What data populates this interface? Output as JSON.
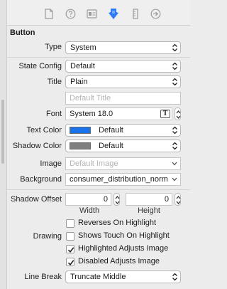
{
  "section_title": "Button",
  "type": {
    "label": "Type",
    "value": "System"
  },
  "state_config": {
    "label": "State Config",
    "value": "Default"
  },
  "title": {
    "label": "Title",
    "value": "Plain",
    "placeholder": "Default Title"
  },
  "font": {
    "label": "Font",
    "value": "System 18.0",
    "button_glyph": "T"
  },
  "text_color": {
    "label": "Text Color",
    "value": "Default",
    "swatch": "#1a73e8"
  },
  "shadow_color": {
    "label": "Shadow Color",
    "value": "Default",
    "swatch": "#7f7f7f"
  },
  "image": {
    "label": "Image",
    "placeholder": "Default Image"
  },
  "background": {
    "label": "Background",
    "value": "consumer_distribution_norm"
  },
  "shadow_offset": {
    "label": "Shadow Offset",
    "width_value": "0",
    "height_value": "0",
    "width_label": "Width",
    "height_label": "Height"
  },
  "drawing": {
    "label": "Drawing",
    "options": [
      {
        "label": "Reverses On Highlight",
        "checked": false
      },
      {
        "label": "Shows Touch On Highlight",
        "checked": false
      },
      {
        "label": "Highlighted Adjusts Image",
        "checked": true
      },
      {
        "label": "Disabled Adjusts Image",
        "checked": true
      }
    ]
  },
  "line_break": {
    "label": "Line Break",
    "value": "Truncate Middle"
  },
  "colors": {
    "accent": "#2f7bf5",
    "tab_inactive": "#9b9b9b"
  }
}
